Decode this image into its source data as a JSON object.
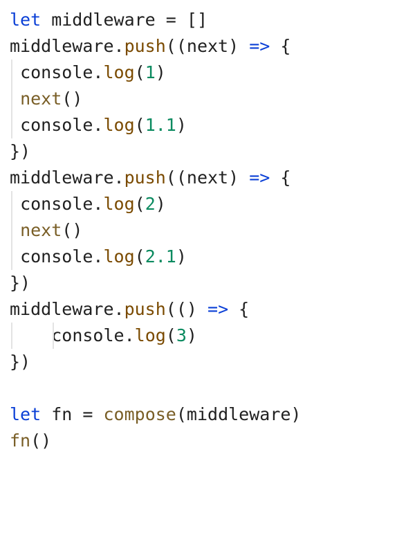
{
  "code": {
    "plain_text": "let middleware = []\nmiddleware.push((next) => {\n console.log(1)\n next()\n console.log(1.1)\n})\nmiddleware.push((next) => {\n console.log(2)\n next()\n console.log(2.1)\n})\nmiddleware.push(() => {\n    console.log(3)\n})\n\nlet fn = compose(middleware)\nfn()",
    "lines": [
      {
        "indent": 0,
        "tokens": [
          {
            "t": "let",
            "c": "tok-kw"
          },
          {
            "t": " middleware ",
            "c": "tok-def"
          },
          {
            "t": "=",
            "c": "tok-punc"
          },
          {
            "t": " []",
            "c": "tok-punc"
          }
        ]
      },
      {
        "indent": 0,
        "tokens": [
          {
            "t": "middleware",
            "c": "tok-obj"
          },
          {
            "t": ".",
            "c": "tok-punc"
          },
          {
            "t": "push",
            "c": "tok-prop"
          },
          {
            "t": "((",
            "c": "tok-punc"
          },
          {
            "t": "next",
            "c": "tok-obj"
          },
          {
            "t": ") ",
            "c": "tok-punc"
          },
          {
            "t": "=>",
            "c": "tok-arrow"
          },
          {
            "t": " {",
            "c": "tok-punc"
          }
        ]
      },
      {
        "indent": 1,
        "guide": "guide",
        "tokens": [
          {
            "t": "console",
            "c": "tok-obj"
          },
          {
            "t": ".",
            "c": "tok-punc"
          },
          {
            "t": "log",
            "c": "tok-prop"
          },
          {
            "t": "(",
            "c": "tok-punc"
          },
          {
            "t": "1",
            "c": "tok-num"
          },
          {
            "t": ")",
            "c": "tok-punc"
          }
        ]
      },
      {
        "indent": 1,
        "guide": "guide",
        "tokens": [
          {
            "t": "next",
            "c": "tok-fn"
          },
          {
            "t": "()",
            "c": "tok-punc"
          }
        ]
      },
      {
        "indent": 1,
        "guide": "guide",
        "tokens": [
          {
            "t": "console",
            "c": "tok-obj"
          },
          {
            "t": ".",
            "c": "tok-punc"
          },
          {
            "t": "log",
            "c": "tok-prop"
          },
          {
            "t": "(",
            "c": "tok-punc"
          },
          {
            "t": "1.1",
            "c": "tok-num"
          },
          {
            "t": ")",
            "c": "tok-punc"
          }
        ]
      },
      {
        "indent": 0,
        "tokens": [
          {
            "t": "})",
            "c": "tok-punc"
          }
        ]
      },
      {
        "indent": 0,
        "tokens": [
          {
            "t": "middleware",
            "c": "tok-obj"
          },
          {
            "t": ".",
            "c": "tok-punc"
          },
          {
            "t": "push",
            "c": "tok-prop"
          },
          {
            "t": "((",
            "c": "tok-punc"
          },
          {
            "t": "next",
            "c": "tok-obj"
          },
          {
            "t": ") ",
            "c": "tok-punc"
          },
          {
            "t": "=>",
            "c": "tok-arrow"
          },
          {
            "t": " {",
            "c": "tok-punc"
          }
        ]
      },
      {
        "indent": 1,
        "guide": "guide",
        "tokens": [
          {
            "t": "console",
            "c": "tok-obj"
          },
          {
            "t": ".",
            "c": "tok-punc"
          },
          {
            "t": "log",
            "c": "tok-prop"
          },
          {
            "t": "(",
            "c": "tok-punc"
          },
          {
            "t": "2",
            "c": "tok-num"
          },
          {
            "t": ")",
            "c": "tok-punc"
          }
        ]
      },
      {
        "indent": 1,
        "guide": "guide",
        "tokens": [
          {
            "t": "next",
            "c": "tok-fn"
          },
          {
            "t": "()",
            "c": "tok-punc"
          }
        ]
      },
      {
        "indent": 1,
        "guide": "guide",
        "tokens": [
          {
            "t": "console",
            "c": "tok-obj"
          },
          {
            "t": ".",
            "c": "tok-punc"
          },
          {
            "t": "log",
            "c": "tok-prop"
          },
          {
            "t": "(",
            "c": "tok-punc"
          },
          {
            "t": "2.1",
            "c": "tok-num"
          },
          {
            "t": ")",
            "c": "tok-punc"
          }
        ]
      },
      {
        "indent": 0,
        "tokens": [
          {
            "t": "})",
            "c": "tok-punc"
          }
        ]
      },
      {
        "indent": 0,
        "tokens": [
          {
            "t": "middleware",
            "c": "tok-obj"
          },
          {
            "t": ".",
            "c": "tok-punc"
          },
          {
            "t": "push",
            "c": "tok-prop"
          },
          {
            "t": "(() ",
            "c": "tok-punc"
          },
          {
            "t": "=>",
            "c": "tok-arrow"
          },
          {
            "t": " {",
            "c": "tok-punc"
          }
        ]
      },
      {
        "indent": 4,
        "guide": "guide2",
        "tokens": [
          {
            "t": "console",
            "c": "tok-obj"
          },
          {
            "t": ".",
            "c": "tok-punc"
          },
          {
            "t": "log",
            "c": "tok-prop"
          },
          {
            "t": "(",
            "c": "tok-punc"
          },
          {
            "t": "3",
            "c": "tok-num"
          },
          {
            "t": ")",
            "c": "tok-punc"
          }
        ]
      },
      {
        "indent": 0,
        "tokens": [
          {
            "t": "})",
            "c": "tok-punc"
          }
        ]
      },
      {
        "indent": 0,
        "tokens": []
      },
      {
        "indent": 0,
        "tokens": [
          {
            "t": "let",
            "c": "tok-kw"
          },
          {
            "t": " fn ",
            "c": "tok-def"
          },
          {
            "t": "=",
            "c": "tok-punc"
          },
          {
            "t": " ",
            "c": "tok-punc"
          },
          {
            "t": "compose",
            "c": "tok-fn"
          },
          {
            "t": "(middleware)",
            "c": "tok-punc"
          }
        ]
      },
      {
        "indent": 0,
        "tokens": [
          {
            "t": "fn",
            "c": "tok-fn"
          },
          {
            "t": "()",
            "c": "tok-punc"
          }
        ]
      }
    ]
  }
}
